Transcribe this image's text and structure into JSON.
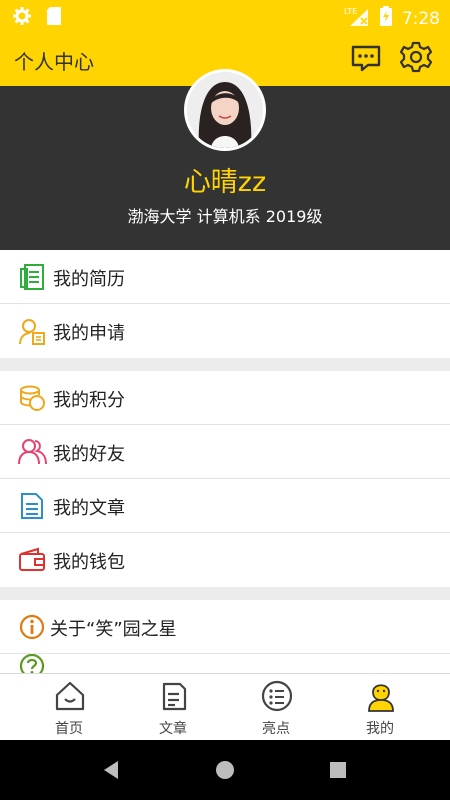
{
  "status_bar": {
    "network": "LTE",
    "time": "7:28"
  },
  "header": {
    "title": "个人中心"
  },
  "profile": {
    "name": "心晴zz",
    "school": "渤海大学 计算机系 2019级"
  },
  "menu": {
    "group1": [
      {
        "label": "我的简历",
        "icon": "resume-icon",
        "color": "#2fae3c"
      },
      {
        "label": "我的申请",
        "icon": "application-icon",
        "color": "#f0a818"
      }
    ],
    "group2": [
      {
        "label": "我的积分",
        "icon": "coins-icon",
        "color": "#f0a818"
      },
      {
        "label": "我的好友",
        "icon": "friends-icon",
        "color": "#e8426e"
      },
      {
        "label": "我的文章",
        "icon": "article-icon",
        "color": "#2a90c8"
      },
      {
        "label": "我的钱包",
        "icon": "wallet-icon",
        "color": "#e03030"
      }
    ],
    "group3": [
      {
        "label": "关于“笑”园之星",
        "icon": "info-icon",
        "color": "#e07a10"
      },
      {
        "label": "",
        "icon": "help-icon",
        "color": "#5a9a20"
      }
    ]
  },
  "tabs": [
    {
      "label": "首页",
      "icon": "home-icon"
    },
    {
      "label": "文章",
      "icon": "article-tab-icon"
    },
    {
      "label": "亮点",
      "icon": "highlight-icon"
    },
    {
      "label": "我的",
      "icon": "me-icon",
      "active": true
    }
  ],
  "colors": {
    "accent": "#ffd400",
    "profile_bg": "#333333"
  }
}
